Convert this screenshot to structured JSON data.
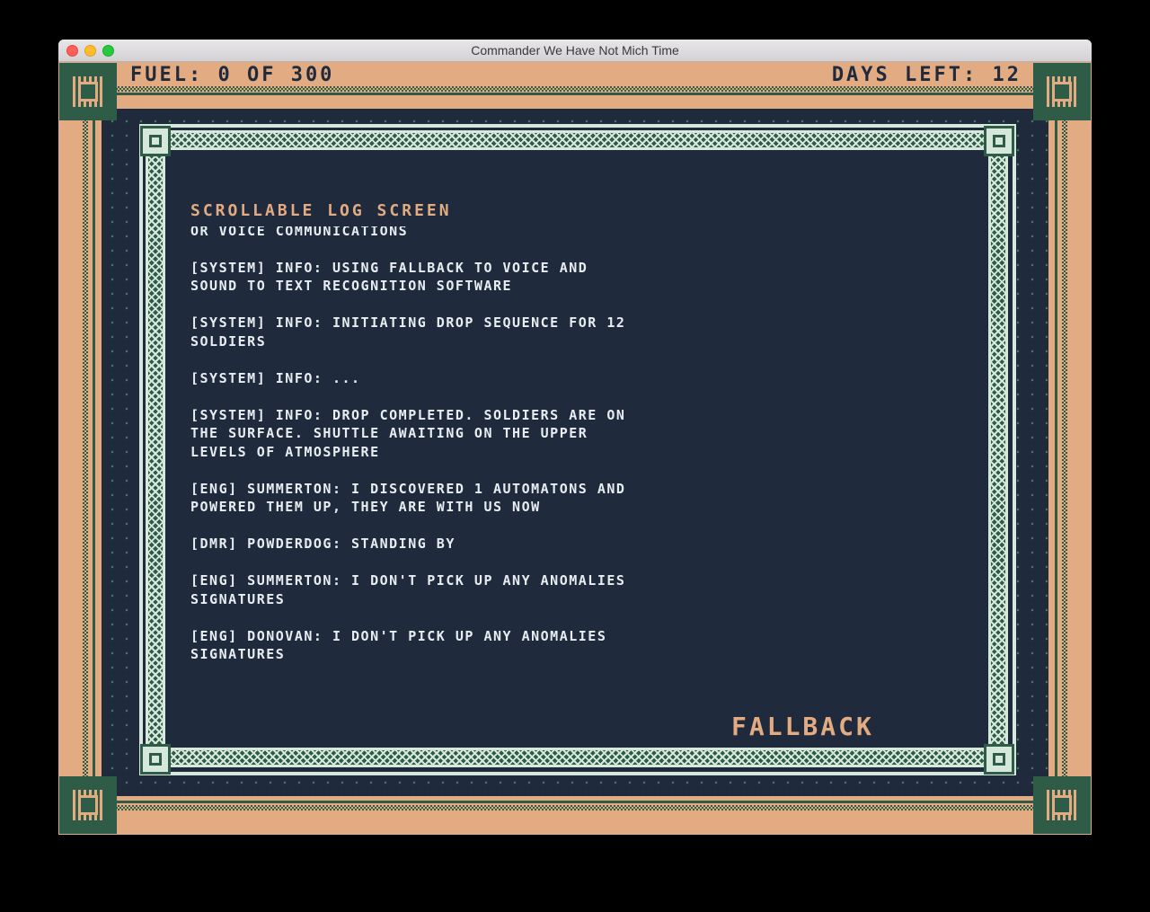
{
  "window": {
    "title": "Commander We Have Not Mich Time"
  },
  "hud": {
    "fuel": "FUEL: 0 OF 300",
    "days_left": "DAYS LEFT: 12"
  },
  "log": {
    "heading": "Scrollable Log Screen",
    "entries": [
      "[SYSTEM] INFO: WARNING: CANNOT ESTABLISH VIDEO\nOR VOICE COMMUNICATIONS",
      "[SYSTEM] INFO: USING FALLBACK TO VOICE AND\nSOUND TO TEXT RECOGNITION SOFTWARE",
      "[SYSTEM] INFO: INITIATING DROP SEQUENCE FOR 12\nSOLDIERS",
      "[SYSTEM] INFO: ...",
      "[SYSTEM] INFO: DROP COMPLETED. SOLDIERS ARE ON\nTHE SURFACE. SHUTTLE AWAITING ON THE UPPER\nLEVELS OF ATMOSPHERE",
      "[ENG] SUMMERTON: I DISCOVERED 1 AUTOMATONS AND\nPOWERED THEM UP, THEY ARE WITH US NOW",
      "[DMR] POWDERDOG: STANDING BY",
      "[ENG] SUMMERTON: I DON'T PICK UP ANY ANOMALIES\nSIGNATURES",
      "[ENG] DONOVAN: I DON'T PICK UP ANY ANOMALIES\nSIGNATURES"
    ]
  },
  "status": {
    "mode_label": "FALLBACK"
  },
  "colors": {
    "background_tan": "#e2ab82",
    "panel_navy": "#1f2a3c",
    "frame_green": "#2e5c46",
    "frame_light": "#d6e7dc",
    "text_light": "#e8edf2",
    "accent_orange": "#e2ab82"
  }
}
